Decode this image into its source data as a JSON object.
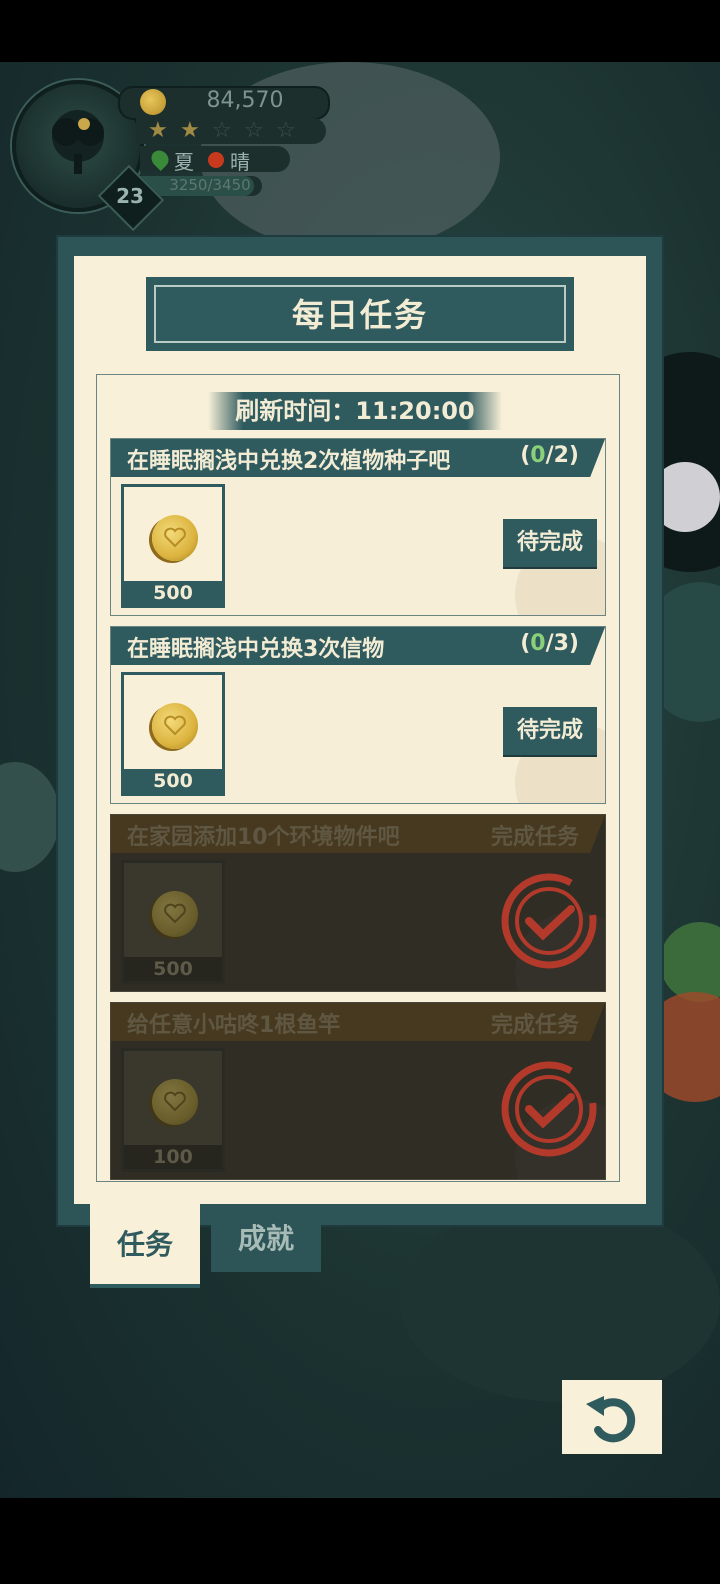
{
  "hud": {
    "coins": "84,570",
    "stars_filled": 2,
    "stars_total": 5,
    "season": "夏",
    "weather": "晴",
    "exp": "3250/3450",
    "exp_fraction": 0.942,
    "level": "23"
  },
  "panel": {
    "title": "每日任务",
    "refresh_label": "刷新时间：11:20:00"
  },
  "tasks": [
    {
      "name": "在睡眠搁浅中兑换2次植物种子吧",
      "progress_open": "(",
      "progress_done": "0",
      "progress_rest": "/2)",
      "reward": "500",
      "status": "待完成"
    },
    {
      "name": "在睡眠搁浅中兑换3次信物",
      "progress_open": "(",
      "progress_done": "0",
      "progress_rest": "/3)",
      "reward": "500",
      "status": "待完成"
    },
    {
      "name": "在家园添加10个环境物件吧",
      "progress_text": "完成任务",
      "reward": "500"
    },
    {
      "name": "给任意小咕咚1根鱼竿",
      "progress_text": "完成任务",
      "reward": "100"
    }
  ],
  "tabs": {
    "task": "任务",
    "achievement": "成就"
  },
  "colors": {
    "panel_teal": "#2f5a5e",
    "paper": "#f8f0d8",
    "progress_green": "#8ad07a",
    "stamp_red": "#b33a2a"
  }
}
